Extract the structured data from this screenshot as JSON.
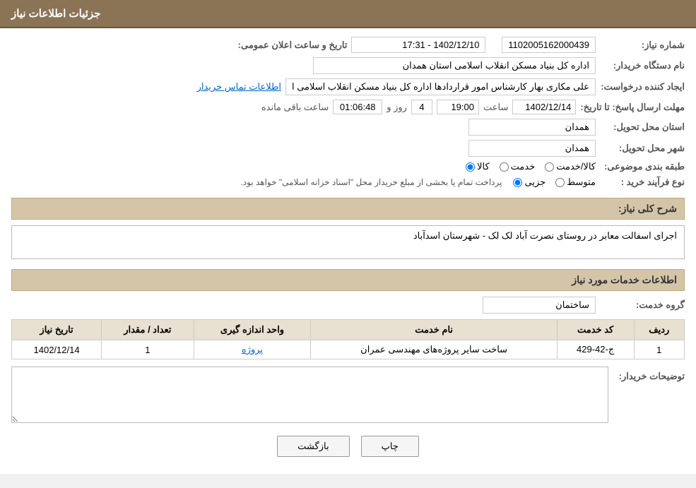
{
  "header": {
    "title": "جزئیات اطلاعات نیاز"
  },
  "fields": {
    "request_number_label": "شماره نیاز:",
    "request_number_value": "1102005162000439",
    "announce_datetime_label": "تاریخ و ساعت اعلان عمومی:",
    "announce_datetime_value": "1402/12/10 - 17:31",
    "buyer_org_label": "نام دستگاه خریدار:",
    "buyer_org_value": "اداره کل بنیاد مسکن انقلاب اسلامی استان همدان",
    "creator_label": "ایجاد کننده درخواست:",
    "creator_value": "علی مکاری بهار کارشناس امور قراردادها اداره کل بنیاد مسکن انقلاب اسلامی ا",
    "creator_link": "اطلاعات تماس خریدار",
    "deadline_label": "مهلت ارسال پاسخ: تا تاریخ:",
    "deadline_date": "1402/12/14",
    "deadline_time": "19:00",
    "deadline_days": "4",
    "deadline_remaining": "01:06:48",
    "deadline_days_label": "روز و",
    "deadline_remaining_label": "ساعت باقی مانده",
    "province_label": "استان محل تحویل:",
    "province_value": "همدان",
    "city_label": "شهر محل تحویل:",
    "city_value": "همدان",
    "category_label": "طبقه بندی موضوعی:",
    "category_kala": "کالا",
    "category_khadamat": "خدمت",
    "category_kala_khadamat": "کالا/خدمت",
    "process_label": "نوع فرآیند خرید :",
    "process_jozvi": "جزیی",
    "process_motavaset": "متوسط",
    "process_note": "پرداخت تمام یا بخشی از مبلغ خریداز محل \"اسناد خزانه اسلامی\" خواهد بود.",
    "general_desc_label": "شرح کلی نیاز:",
    "general_desc_value": "اجرای اسفالت معابر در روستای نصرت آباد لک لک - شهرستان اسدآباد",
    "service_info_title": "اطلاعات خدمات مورد نیاز",
    "service_group_label": "گروه خدمت:",
    "service_group_value": "ساختمان",
    "table": {
      "headers": [
        "ردیف",
        "کد خدمت",
        "نام خدمت",
        "واحد اندازه گیری",
        "تعداد / مقدار",
        "تاریخ نیاز"
      ],
      "rows": [
        {
          "row": "1",
          "code": "ج-42-429",
          "name": "ساخت سایر پروژه‌های مهندسی عمران",
          "unit": "پروژه",
          "quantity": "1",
          "date": "1402/12/14"
        }
      ]
    },
    "buyer_desc_label": "توضیحات خریدار:",
    "buyer_desc_value": ""
  },
  "buttons": {
    "print": "چاپ",
    "back": "بازگشت"
  }
}
